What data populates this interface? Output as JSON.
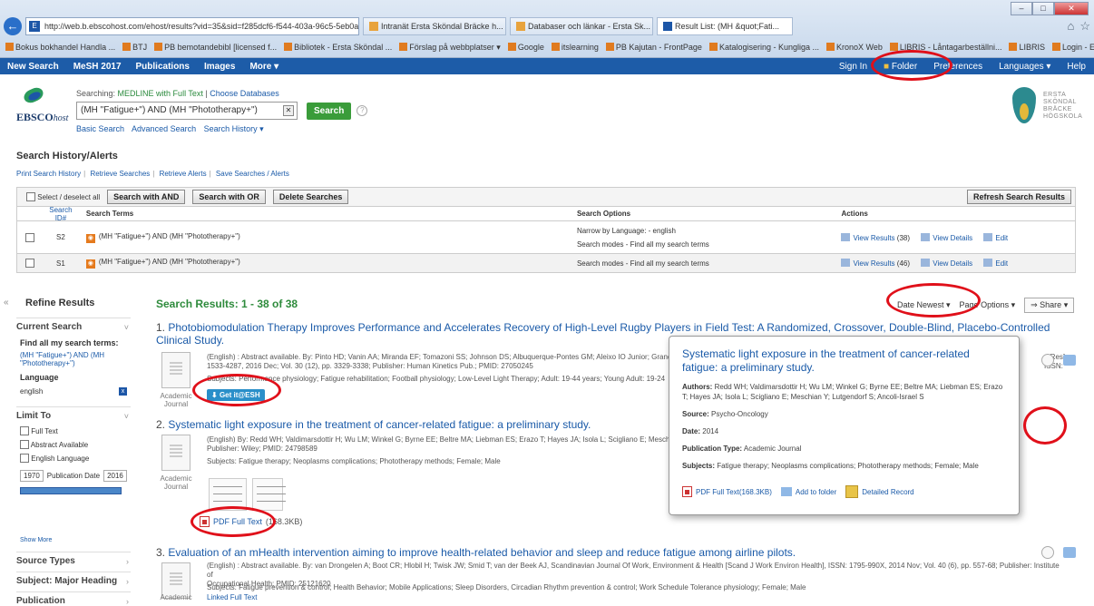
{
  "browser": {
    "url": "http://web.b.ebscohost.com/ehost/results?vid=35&sid=f285dcf6-f544-403a-96c5-5eb0a",
    "tabs": [
      {
        "label": "Intranät Ersta Sköndal Bräcke h..."
      },
      {
        "label": "Databaser och länkar - Ersta Sk..."
      },
      {
        "label": "Result List: (MH &quot;Fati..."
      }
    ],
    "favorites": [
      "Bokus bokhandel Handla ...",
      "BTJ",
      "PB bemotandebibl [licensed f...",
      "Bibliotek - Ersta Sköndal ...",
      "Förslag på webbplatser ▾",
      "Google",
      "itslearning",
      "PB Kajutan - FrontPage",
      "Katalogisering - Kungliga ...",
      "KronoX Web",
      "LIBRIS - Låntagarbeställni...",
      "LIBRIS",
      "Login - Ersta Sköndal Hög..."
    ]
  },
  "topnav": {
    "left": [
      "New Search",
      "MeSH 2017",
      "Publications",
      "Images",
      "More ▾"
    ],
    "right": [
      "Sign In",
      "Folder",
      "Preferences",
      "Languages ▾",
      "Help"
    ]
  },
  "logo": {
    "ebsco": "EBSCO",
    "host": "host"
  },
  "search": {
    "searching_label": "Searching:",
    "database": "MEDLINE with Full Text",
    "choose": "Choose Databases",
    "query": "(MH \"Fatigue+\") AND (MH \"Phototherapy+\")",
    "button": "Search",
    "links": [
      "Basic Search",
      "Advanced Search",
      "Search History ▾"
    ]
  },
  "ersta": [
    "ERSTA",
    "SKÖNDAL",
    "BRÄCKE",
    "HÖGSKOLA"
  ],
  "history": {
    "title": "Search History/Alerts",
    "links": [
      "Print Search History",
      "Retrieve Searches",
      "Retrieve Alerts",
      "Save Searches / Alerts"
    ],
    "select_all": "Select / deselect all",
    "btn_and": "Search with AND",
    "btn_or": "Search with OR",
    "btn_delete": "Delete Searches",
    "btn_refresh": "Refresh Search Results",
    "headers": {
      "id": "Search ID#",
      "terms": "Search Terms",
      "options": "Search Options",
      "actions": "Actions"
    },
    "rows": [
      {
        "id": "S2",
        "terms": "(MH \"Fatigue+\") AND (MH \"Phototherapy+\")",
        "narrow": "Narrow by Language: - english",
        "modes": "Search modes - Find all my search terms",
        "view_results": "View Results",
        "count": "(38)",
        "view_details": "View Details",
        "edit": "Edit"
      },
      {
        "id": "S1",
        "terms": "(MH \"Fatigue+\") AND (MH \"Phototherapy+\")",
        "narrow": "",
        "modes": "Search modes - Find all my search terms",
        "view_results": "View Results",
        "count": "(46)",
        "view_details": "View Details",
        "edit": "Edit"
      }
    ]
  },
  "sidebar": {
    "title": "Refine Results",
    "current_search": "Current Search",
    "find_all": "Find all my search terms:",
    "query": "(MH \"Fatigue+\") AND (MH \"Phototherapy+\")",
    "language_label": "Language",
    "language": "english",
    "limit_to": "Limit To",
    "limits": [
      "Full Text",
      "Abstract Available",
      "English Language"
    ],
    "date_from": "1970",
    "date_label": "Publication Date",
    "date_to": "2016",
    "show_more": "Show More",
    "sections": [
      "Source Types",
      "Subject: Major Heading",
      "Publication"
    ]
  },
  "results": {
    "heading": "Search Results: 1 - 38 of 38",
    "sort": "Date Newest ▾",
    "page_options": "Page Options ▾",
    "share": "Share ▾",
    "items": [
      {
        "n": "1.",
        "title": "Photobiomodulation Therapy Improves Performance and Accelerates Recovery of High-Level Rugby Players in Field Test: A Randomized, Crossover, Double-Blind, Placebo-Controlled Clinical Study.",
        "meta1": "(English) : Abstract available. By: Pinto HD; Vanin AA; Miranda EF; Tomazoni SS; Johnson DS; Albuquerque-Pontes GM; Aleixo IO Junior; Grandinetti",
        "meta1b": "d Res], ISSN:",
        "meta2": "1533-4287, 2016 Dec; Vol. 30 (12), pp. 3329-3338; Publisher: Human Kinetics Pub.; PMID: 27050245",
        "subjects": "Subjects: Performance physiology; Fatigue rehabilitation; Football physiology; Low-Level Light Therapy; Adult: 19-44 years; Young Adult: 19-24",
        "type": "Academic Journal",
        "getit": "Get it@ESH"
      },
      {
        "n": "2.",
        "title": "Systematic light exposure in the treatment of cancer-related fatigue: a preliminary study.",
        "meta1": "(English) By: Redd WH; Valdimarsdottir H; Wu LM; Winkel G; Byrne EE; Beltre MA; Liebman ES; Erazo T; Hayes JA; Isola L; Scigliano E; Meschian Y;",
        "meta2": "Publisher: Wiley; PMID: 24798589",
        "subjects": "Subjects: Fatigue therapy; Neoplasms complications; Phototherapy methods; Female; Male",
        "type": "Academic Journal",
        "pdf": "PDF Full Text",
        "pdf_size": "(168.3KB)"
      },
      {
        "n": "3.",
        "title": "Evaluation of an mHealth intervention aiming to improve health-related behavior and sleep and reduce fatigue among airline pilots.",
        "meta1": "(English) : Abstract available. By: van Drongelen A; Boot CR; Hlobil H; Twisk JW; Smid T; van der Beek AJ, Scandinavian Journal Of Work, Environment & Health [Scand J Work Environ Health], ISSN: 1795-990X, 2014 Nov; Vol. 40 (6), pp. 557-68; Publisher: Institute of",
        "meta2": "Occupational Health; PMID: 25121620",
        "subjects": "Subjects: Fatigue prevention & control; Health Behavior; Mobile Applications; Sleep Disorders, Circadian Rhythm prevention & control; Work Schedule Tolerance physiology; Female; Male",
        "type": "Academic",
        "linked": "Linked Full Text"
      }
    ]
  },
  "popup": {
    "title": "Systematic light exposure in the treatment of cancer-related fatigue: a preliminary study.",
    "authors_label": "Authors:",
    "authors": "Redd WH; Valdimarsdottir H; Wu LM; Winkel G; Byrne EE; Beltre MA; Liebman ES; Erazo T; Hayes JA; Isola L; Scigliano E; Meschian Y; Lutgendorf S; Ancoli-Israel S",
    "source_label": "Source:",
    "source": "Psycho-Oncology",
    "date_label": "Date:",
    "date": "2014",
    "ptype_label": "Publication Type:",
    "ptype": "Academic Journal",
    "subjects_label": "Subjects:",
    "subjects": "Fatigue therapy; Neoplasms complications; Phototherapy methods; Female; Male",
    "pdf": "PDF Full Text(168.3KB)",
    "add_folder": "Add to folder",
    "detailed": "Detailed Record"
  },
  "colors": {
    "nav": "#1d5ca8",
    "results_heading": "#2e8b3c",
    "link": "#1a5aa8",
    "highlight_ring": "#e0101a"
  }
}
